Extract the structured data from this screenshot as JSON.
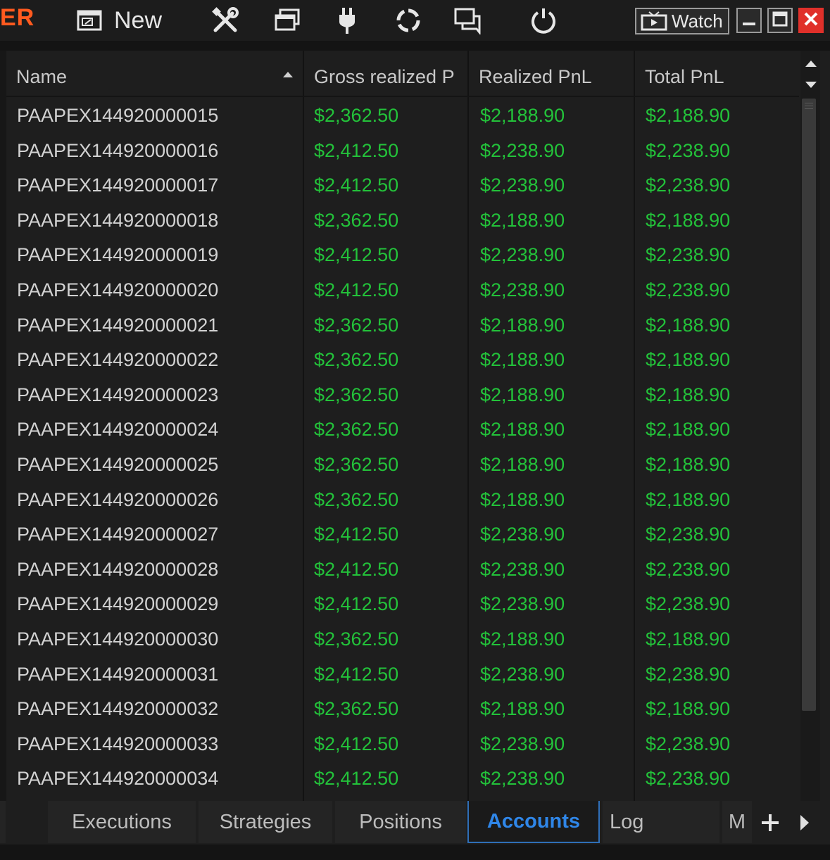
{
  "toolbar": {
    "brand_fragment": "ER",
    "new_label": "New",
    "watch_label": "Watch",
    "icons": [
      "new-window-icon",
      "tools-icon",
      "workspaces-icon",
      "connection-plug-icon",
      "sync-icon",
      "chat-icon",
      "power-icon",
      "watch-video-icon",
      "minimize-icon",
      "maximize-icon",
      "close-icon"
    ]
  },
  "table": {
    "columns": [
      "Name",
      "Gross realized P",
      "Realized PnL",
      "Total PnL"
    ],
    "sort": {
      "column": "Name",
      "direction": "ascending"
    },
    "rows": [
      {
        "name": "PAAPEX144920000015",
        "gross": "$2,362.50",
        "realized": "$2,188.90",
        "total": "$2,188.90"
      },
      {
        "name": "PAAPEX144920000016",
        "gross": "$2,412.50",
        "realized": "$2,238.90",
        "total": "$2,238.90"
      },
      {
        "name": "PAAPEX144920000017",
        "gross": "$2,412.50",
        "realized": "$2,238.90",
        "total": "$2,238.90"
      },
      {
        "name": "PAAPEX144920000018",
        "gross": "$2,362.50",
        "realized": "$2,188.90",
        "total": "$2,188.90"
      },
      {
        "name": "PAAPEX144920000019",
        "gross": "$2,412.50",
        "realized": "$2,238.90",
        "total": "$2,238.90"
      },
      {
        "name": "PAAPEX144920000020",
        "gross": "$2,412.50",
        "realized": "$2,238.90",
        "total": "$2,238.90"
      },
      {
        "name": "PAAPEX144920000021",
        "gross": "$2,362.50",
        "realized": "$2,188.90",
        "total": "$2,188.90"
      },
      {
        "name": "PAAPEX144920000022",
        "gross": "$2,362.50",
        "realized": "$2,188.90",
        "total": "$2,188.90"
      },
      {
        "name": "PAAPEX144920000023",
        "gross": "$2,362.50",
        "realized": "$2,188.90",
        "total": "$2,188.90"
      },
      {
        "name": "PAAPEX144920000024",
        "gross": "$2,362.50",
        "realized": "$2,188.90",
        "total": "$2,188.90"
      },
      {
        "name": "PAAPEX144920000025",
        "gross": "$2,362.50",
        "realized": "$2,188.90",
        "total": "$2,188.90"
      },
      {
        "name": "PAAPEX144920000026",
        "gross": "$2,362.50",
        "realized": "$2,188.90",
        "total": "$2,188.90"
      },
      {
        "name": "PAAPEX144920000027",
        "gross": "$2,412.50",
        "realized": "$2,238.90",
        "total": "$2,238.90"
      },
      {
        "name": "PAAPEX144920000028",
        "gross": "$2,412.50",
        "realized": "$2,238.90",
        "total": "$2,238.90"
      },
      {
        "name": "PAAPEX144920000029",
        "gross": "$2,412.50",
        "realized": "$2,238.90",
        "total": "$2,238.90"
      },
      {
        "name": "PAAPEX144920000030",
        "gross": "$2,362.50",
        "realized": "$2,188.90",
        "total": "$2,188.90"
      },
      {
        "name": "PAAPEX144920000031",
        "gross": "$2,412.50",
        "realized": "$2,238.90",
        "total": "$2,238.90"
      },
      {
        "name": "PAAPEX144920000032",
        "gross": "$2,362.50",
        "realized": "$2,188.90",
        "total": "$2,188.90"
      },
      {
        "name": "PAAPEX144920000033",
        "gross": "$2,412.50",
        "realized": "$2,238.90",
        "total": "$2,238.90"
      },
      {
        "name": "PAAPEX144920000034",
        "gross": "$2,412.50",
        "realized": "$2,238.90",
        "total": "$2,238.90"
      }
    ]
  },
  "tabs": {
    "items": [
      "Executions",
      "Strategies",
      "Positions",
      "Accounts",
      "Log",
      "M"
    ],
    "active": "Accounts"
  },
  "colors": {
    "brand": "#ff5a1f",
    "positive": "#23c23a",
    "active_tab": "#2f86e8",
    "close_button": "#e0302a"
  }
}
